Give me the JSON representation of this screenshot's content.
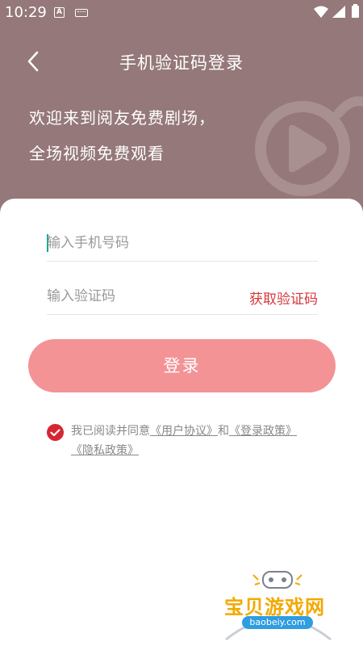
{
  "status_bar": {
    "time": "10:29",
    "notification_a_icon": "A"
  },
  "header": {
    "back_icon": "chevron-left-icon",
    "title": "手机验证码登录",
    "welcome_line1": "欢迎来到阅友免费剧场，",
    "welcome_line2": "全场视频免费观看",
    "background_color": "#957879"
  },
  "form": {
    "phone_placeholder": "输入手机号码",
    "phone_value": "",
    "code_placeholder": "输入验证码",
    "code_value": "",
    "get_code_label": "获取验证码",
    "login_label": "登录"
  },
  "agreement": {
    "checked": true,
    "prefix": "我已阅读并同意",
    "user_agreement": "《用户协议》",
    "and": "和",
    "login_policy": "《登录政策》",
    "privacy_policy": "《隐私政策》"
  },
  "watermark": {
    "text": "宝贝游戏网",
    "url": "baobeiy.com"
  },
  "colors": {
    "accent_red": "#d7383d",
    "button_pink": "#f49396",
    "checkbox_red": "#d72632",
    "caret_teal": "#1aa39a"
  }
}
